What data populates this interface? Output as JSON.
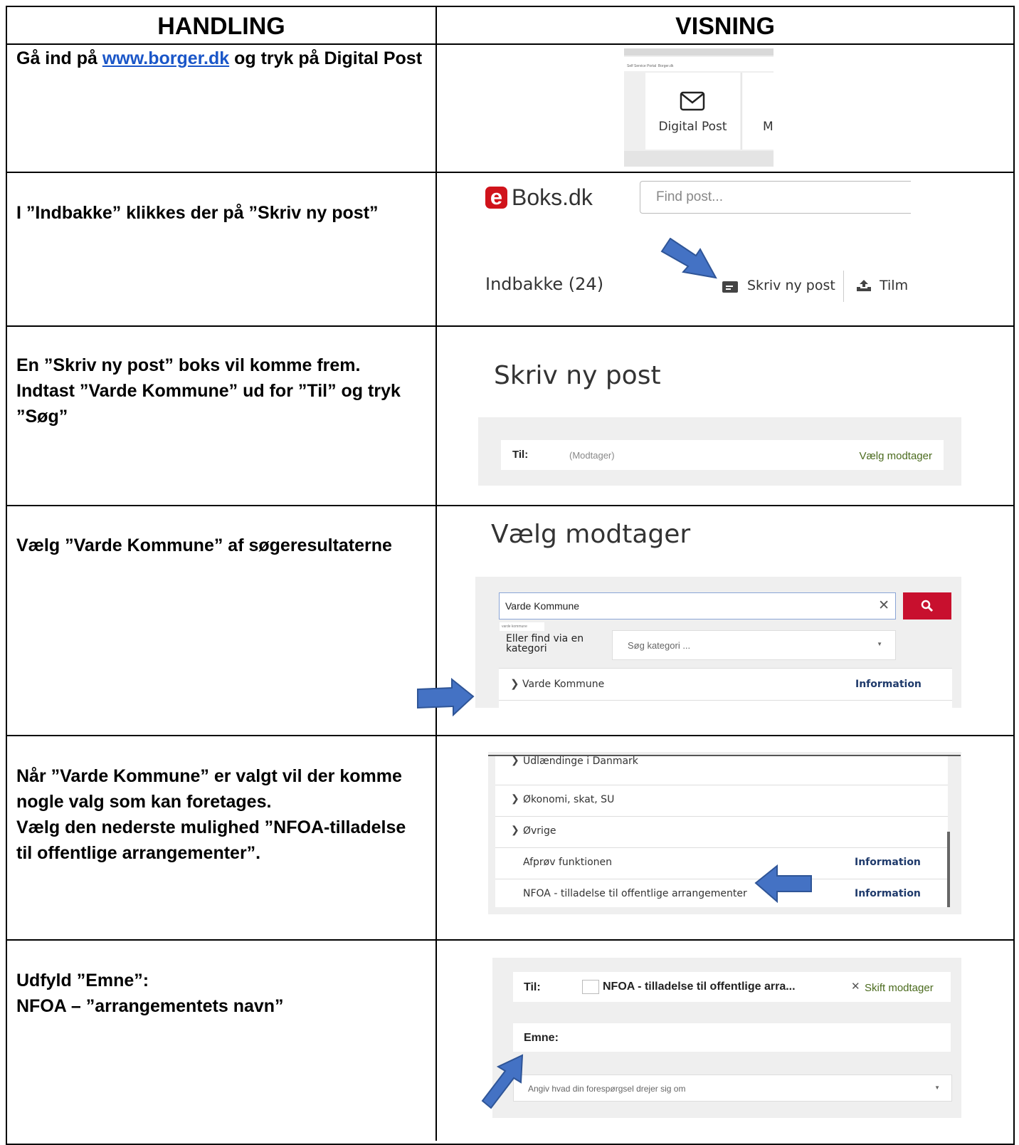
{
  "headers": {
    "action": "HANDLING",
    "view": "VISNING"
  },
  "rows": [
    {
      "action_before_link": "Gå ind på ",
      "link": "www.borger.dk",
      "action_after_link": " og tryk på Digital Post",
      "view": {
        "tile_label": "Digital Post",
        "next_tile": "M",
        "bookmark1": "Self Service Portal",
        "bookmark2": "Borger.dk"
      }
    },
    {
      "action": "I ”Indbakke” klikkes der på ”Skriv ny post”",
      "view": {
        "logo_e": "e",
        "logo_text": "Boks.dk",
        "search_placeholder": "Find post...",
        "inbox": "Indbakke (24)",
        "compose": "Skriv ny post",
        "upload": "Tilm"
      }
    },
    {
      "action": "En ”Skriv ny post” boks vil komme frem. Indtast ”Varde Kommune” ud for ”Til” og tryk ”Søg”",
      "view": {
        "title": "Skriv ny post",
        "to_label": "Til:",
        "to_placeholder": "(Modtager)",
        "choose": "Vælg modtager"
      }
    },
    {
      "action": "Vælg ”Varde Kommune” af søgeresultaterne",
      "view": {
        "title": "Vælg modtager",
        "search_value": "Varde Kommune",
        "suggestion": "varde kommune",
        "category_label": "Eller find via en kategori",
        "category_placeholder": "Søg kategori ...",
        "result": "Varde Kommune",
        "info": "Information"
      }
    },
    {
      "action_lines": [
        "Når ”Varde Kommune” er valgt vil der komme nogle valg som kan foretages.",
        "Vælg den nederste mulighed ”NFOA-tilladelse til offentlige arrangementer”."
      ],
      "view": {
        "items": [
          {
            "label": "Udlændinge i Danmark",
            "info": ""
          },
          {
            "label": "Økonomi, skat, SU",
            "info": ""
          },
          {
            "label": "Øvrige",
            "info": ""
          },
          {
            "label": "Afprøv funktionen",
            "info": "Information"
          },
          {
            "label": "NFOA - tilladelse til offentlige arrangementer",
            "info": "Information"
          }
        ]
      }
    },
    {
      "action_lines": [
        "Udfyld ”Emne”:",
        "NFOA – ”arrangementets navn”"
      ],
      "view": {
        "to_label": "Til:",
        "recipient": "NFOA - tilladelse til offentlige arra...",
        "change": "Skift modtager",
        "subject_label": "Emne:",
        "topic_placeholder": "Angiv hvad din forespørgsel drejer sig om"
      }
    }
  ],
  "colors": {
    "link": "#1a56c8",
    "arrow": "#4472c4",
    "eboks_red": "#d0131b",
    "search_button": "#c8102e",
    "info_blue": "#1f3a6b",
    "choose_green": "#4b6b1e"
  }
}
